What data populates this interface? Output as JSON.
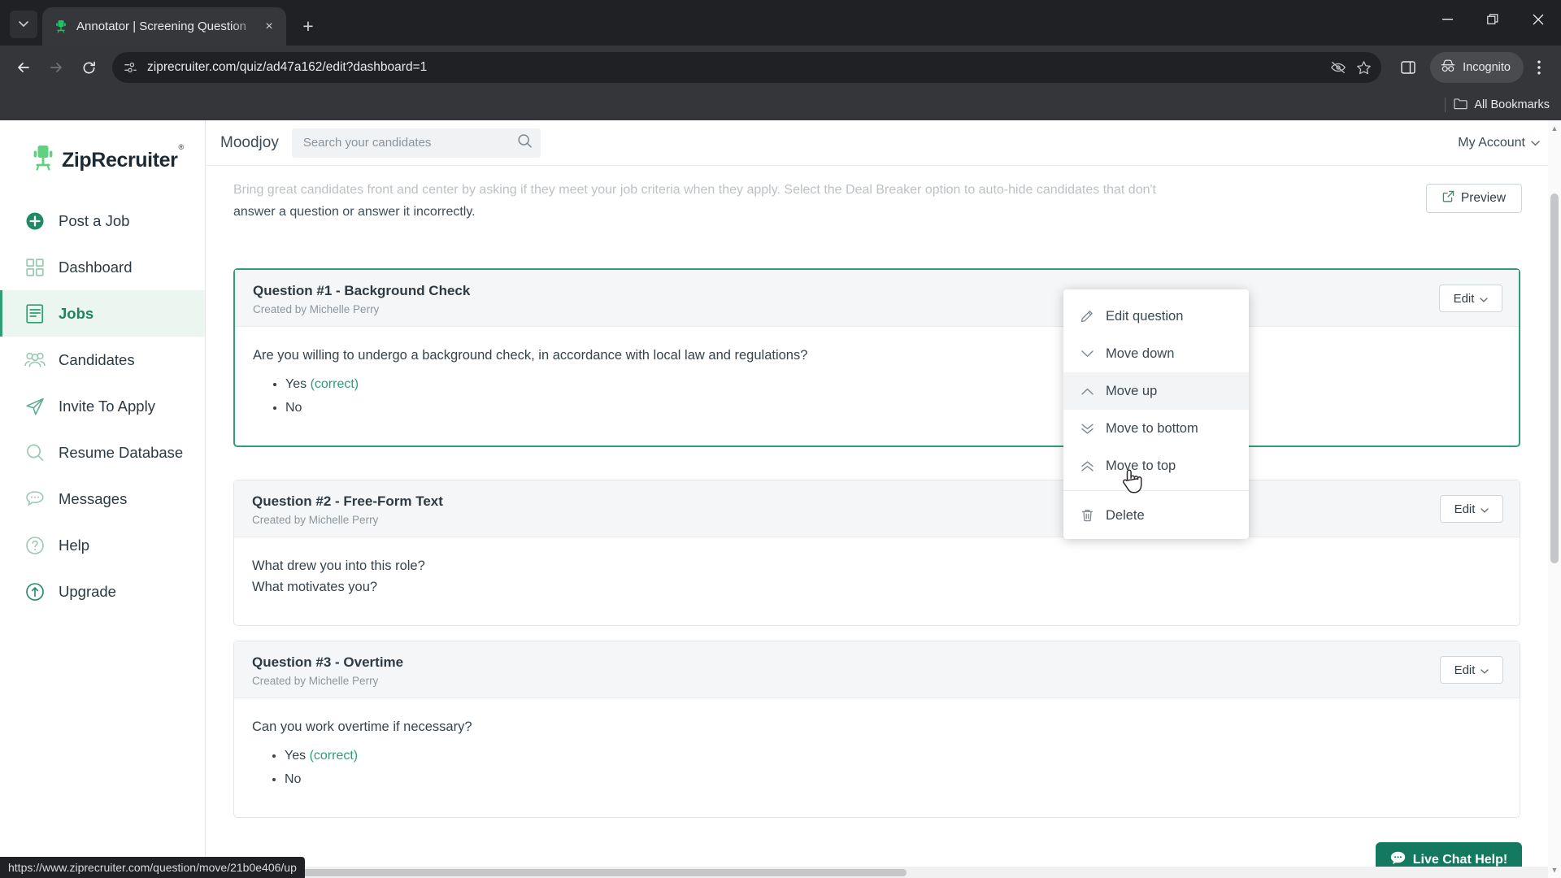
{
  "browser": {
    "tab": {
      "title": "Annotator | Screening Question",
      "favicon": "ziprecruiter-chair-icon",
      "close_label": "×"
    },
    "new_tab_label": "+",
    "window_controls": {
      "minimize": "—",
      "maximize": "❐",
      "close": "✕"
    },
    "toolbar": {
      "back": "←",
      "forward": "→",
      "reload": "↻",
      "url": "ziprecruiter.com/quiz/ad47a162/edit?dashboard=1",
      "site_info_icon": "page-info-icon",
      "tracking_protection_icon": "eye-crossed-icon",
      "bookmark_icon": "star-icon",
      "side_panel_icon": "side-panel-icon",
      "incognito_label": "Incognito",
      "menu_icon": "three-dot-menu-icon"
    },
    "bookmarks": {
      "all_bookmarks_label": "All Bookmarks",
      "folder_icon": "folder-icon"
    },
    "status_url": "https://www.ziprecruiter.com/question/move/21b0e406/up"
  },
  "sidebar": {
    "logo": {
      "text": "ZipRecruiter",
      "trademark": "®"
    },
    "items": [
      {
        "label": "Post a Job",
        "icon": "plus-circle-icon",
        "active": false
      },
      {
        "label": "Dashboard",
        "icon": "grid-icon",
        "active": false
      },
      {
        "label": "Jobs",
        "icon": "document-lines-icon",
        "active": true
      },
      {
        "label": "Candidates",
        "icon": "people-icon",
        "active": false
      },
      {
        "label": "Invite To Apply",
        "icon": "paper-plane-icon",
        "active": false
      },
      {
        "label": "Resume Database",
        "icon": "magnifier-icon",
        "active": false
      },
      {
        "label": "Messages",
        "icon": "chat-bubble-icon",
        "active": false
      },
      {
        "label": "Help",
        "icon": "question-circle-icon",
        "active": false
      },
      {
        "label": "Upgrade",
        "icon": "up-arrow-circle-icon",
        "active": false
      }
    ]
  },
  "appbar": {
    "brand": "Moodjoy",
    "search_placeholder": "Search your candidates",
    "search_value": "",
    "search_icon": "search-icon",
    "account_label": "My Account",
    "account_chevron": "⌄"
  },
  "main": {
    "intro_line1": "Bring great candidates front and center by asking if they meet your job criteria when they apply. Select the Deal Breaker option to auto-hide candidates that don't",
    "intro_line2": "answer a question or answer it incorrectly.",
    "preview_label": "Preview",
    "preview_icon": "external-preview-icon",
    "edit_label": "Edit",
    "edit_chevron": "⌄",
    "questions": [
      {
        "title": "Question #1 - Background Check",
        "created_by": "Created by Michelle Perry",
        "text": "Are you willing to undergo a background check, in accordance with local law and regulations?",
        "options": [
          {
            "label": "Yes",
            "note": "(correct)"
          },
          {
            "label": "No",
            "note": ""
          }
        ],
        "selected": true
      },
      {
        "title": "Question #2 - Free-Form Text",
        "created_by": "Created by Michelle Perry",
        "text_lines": [
          "What drew you into this role?",
          "What motivates you?"
        ],
        "options": [],
        "selected": false
      },
      {
        "title": "Question #3 - Overtime",
        "created_by": "Created by Michelle Perry",
        "text": "Can you work overtime if necessary?",
        "options": [
          {
            "label": "Yes",
            "note": "(correct)"
          },
          {
            "label": "No",
            "note": ""
          }
        ],
        "selected": false
      }
    ]
  },
  "dropdown": {
    "items": [
      {
        "label": "Edit question",
        "icon": "pencil-icon",
        "hover": false
      },
      {
        "label": "Move down",
        "icon": "chevron-down-icon",
        "hover": false
      },
      {
        "label": "Move up",
        "icon": "chevron-up-icon",
        "hover": true
      },
      {
        "label": "Move to bottom",
        "icon": "double-chevron-down-icon",
        "hover": false
      },
      {
        "label": "Move to top",
        "icon": "double-chevron-up-icon",
        "hover": false
      },
      {
        "label": "Delete",
        "icon": "trash-icon",
        "hover": false
      }
    ]
  },
  "livechat": {
    "label": "Live Chat Help!",
    "icon": "chat-icon"
  },
  "colors": {
    "accent_green": "#2f9e76",
    "dark_green": "#13795f",
    "sidebar_active_bg": "#eaf6ef"
  }
}
